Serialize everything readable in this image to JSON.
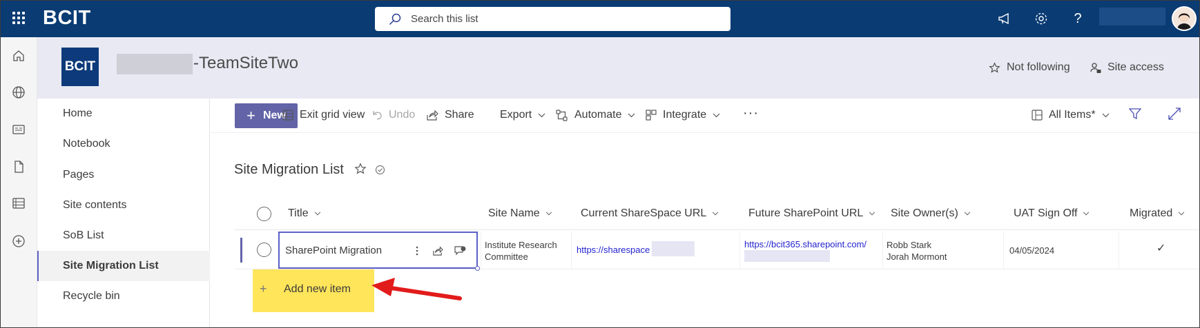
{
  "suite": {
    "brand": "BCIT",
    "search_placeholder": "Search this list"
  },
  "site": {
    "logo_text": "BCIT",
    "title": "-TeamSiteTwo",
    "follow_label": "Not following",
    "access_label": "Site access"
  },
  "nav": {
    "items": [
      "Home",
      "Notebook",
      "Pages",
      "Site contents",
      "SoB List",
      "Site Migration List",
      "Recycle bin"
    ],
    "active": "Site Migration List"
  },
  "commands": {
    "new_label": "New",
    "exit_grid_label": "Exit grid view",
    "undo_label": "Undo",
    "share_label": "Share",
    "export_label": "Export",
    "automate_label": "Automate",
    "integrate_label": "Integrate",
    "more_label": "···",
    "view_label": "All Items*"
  },
  "list": {
    "title": "Site Migration List",
    "columns": [
      "Title",
      "Site Name",
      "Current ShareSpace URL",
      "Future SharePoint URL",
      "Site Owner(s)",
      "UAT Sign Off",
      "Migrated"
    ],
    "rows": [
      {
        "title": "SharePoint Migration",
        "site_name_1": "Institute Research",
        "site_name_2": "Committee",
        "current_url": "https://sharespace",
        "future_url": "https://bcit365.sharepoint.com/",
        "owner_1": "Robb Stark",
        "owner_2": "Jorah Mormont",
        "uat_sign_off": "04/05/2024",
        "migrated": "✓"
      }
    ],
    "add_new_label": "Add new item"
  },
  "colors": {
    "suite_bar": "#0a3b73",
    "accent": "#6264a7",
    "highlight": "#ffe55a",
    "annotation_arrow": "#e21b1b"
  }
}
